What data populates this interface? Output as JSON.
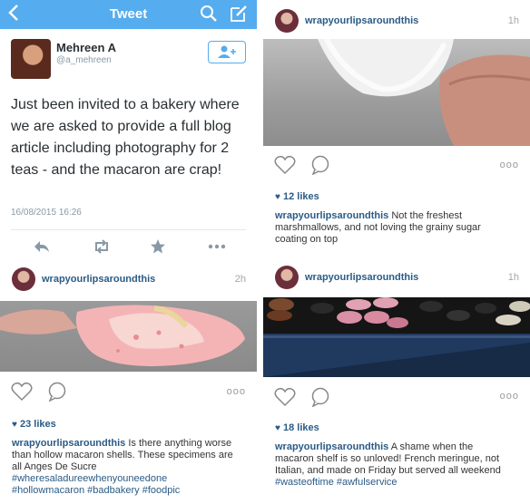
{
  "twitter": {
    "title": "Tweet",
    "back_icon": "chevron-left-icon",
    "search_icon": "search-icon",
    "compose_icon": "compose-icon",
    "bar_color": "#55acee",
    "author_name": "Mehreen A",
    "author_handle": "@a_mehreen",
    "follow_icon": "add-user-icon",
    "text": "Just been invited to a bakery where we are asked to provide a full blog article including photography for 2 teas - and the macaron are crap!",
    "timestamp": "16/08/2015 16:26",
    "actions": [
      "reply-icon",
      "retweet-icon",
      "favorite-icon",
      "more-icon"
    ]
  },
  "posts": [
    {
      "username": "wrapyourlipsaroundthis",
      "time": "1h",
      "likes": "12 likes",
      "caption_user": "wrapyourlipsaroundthis",
      "caption_text": " Not the freshest marshmallows, and not loving the grainy sugar coating on top",
      "caption_tags": "",
      "more": "ooo"
    },
    {
      "username": "wrapyourlipsaroundthis",
      "time": "2h",
      "likes": "23 likes",
      "caption_user": "wrapyourlipsaroundthis",
      "caption_text": " Is there anything worse than hollow macaron shells. These specimens are all Anges De Sucre ",
      "caption_tags": "#wheresaladureewhenyouneedone #hollowmacaron #badbakery #foodpic",
      "more": "ooo"
    },
    {
      "username": "wrapyourlipsaroundthis",
      "time": "1h",
      "likes": "18 likes",
      "caption_user": "wrapyourlipsaroundthis",
      "caption_text": " A shame when the macaron shelf is so unloved! French meringue, not Italian, and made on Friday but served all weekend ",
      "caption_tags": "#wasteoftime #awfulservice",
      "more": "ooo"
    }
  ],
  "colors": {
    "instagram_link": "#2a5b86",
    "twitter_blue": "#55acee"
  }
}
